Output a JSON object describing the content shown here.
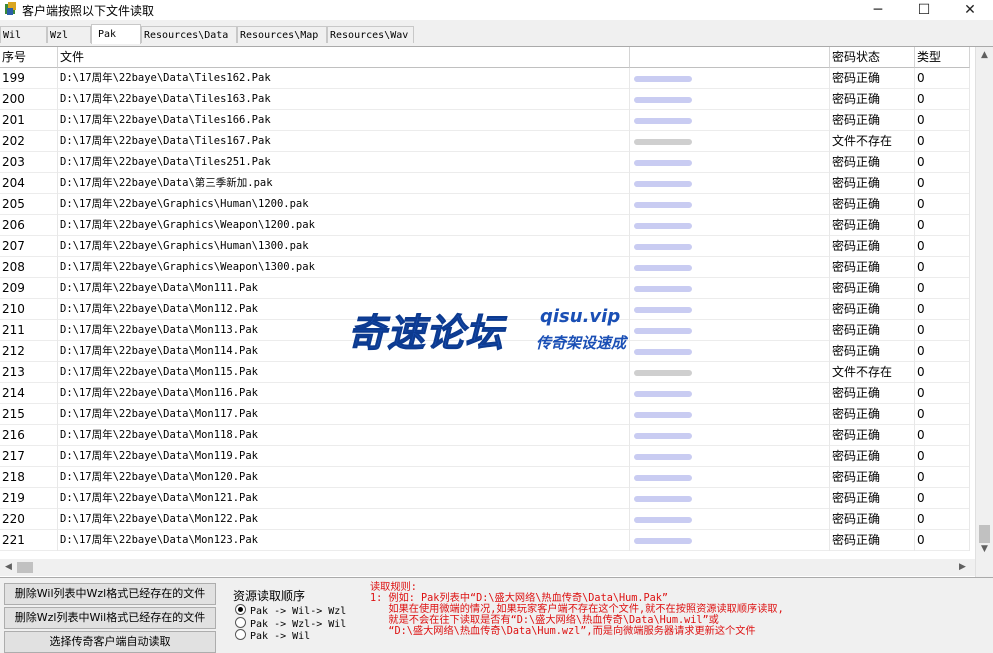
{
  "window": {
    "title": "客户端按照以下文件读取",
    "minimize": "─",
    "maximize": "☐",
    "close": "✕"
  },
  "tabs": [
    "Wil",
    "Wzl",
    "Pak",
    "Resources\\Data",
    "Resources\\Map",
    "Resources\\Wav"
  ],
  "active_tab": "Pak",
  "table": {
    "headers": [
      "序号",
      "文件",
      "",
      "密码状态",
      "类型"
    ],
    "rows": [
      {
        "no": "199",
        "file": "D:\\17周年\\22baye\\Data\\Tiles162.Pak",
        "status": "密码正确",
        "type": "0"
      },
      {
        "no": "200",
        "file": "D:\\17周年\\22baye\\Data\\Tiles163.Pak",
        "status": "密码正确",
        "type": "0"
      },
      {
        "no": "201",
        "file": "D:\\17周年\\22baye\\Data\\Tiles166.Pak",
        "status": "密码正确",
        "type": "0"
      },
      {
        "no": "202",
        "file": "D:\\17周年\\22baye\\Data\\Tiles167.Pak",
        "status": "文件不存在",
        "type": "0"
      },
      {
        "no": "203",
        "file": "D:\\17周年\\22baye\\Data\\Tiles251.Pak",
        "status": "密码正确",
        "type": "0"
      },
      {
        "no": "204",
        "file": "D:\\17周年\\22baye\\Data\\第三季新加.pak",
        "status": "密码正确",
        "type": "0"
      },
      {
        "no": "205",
        "file": "D:\\17周年\\22baye\\Graphics\\Human\\1200.pak",
        "status": "密码正确",
        "type": "0"
      },
      {
        "no": "206",
        "file": "D:\\17周年\\22baye\\Graphics\\Weapon\\1200.pak",
        "status": "密码正确",
        "type": "0"
      },
      {
        "no": "207",
        "file": "D:\\17周年\\22baye\\Graphics\\Human\\1300.pak",
        "status": "密码正确",
        "type": "0"
      },
      {
        "no": "208",
        "file": "D:\\17周年\\22baye\\Graphics\\Weapon\\1300.pak",
        "status": "密码正确",
        "type": "0"
      },
      {
        "no": "209",
        "file": "D:\\17周年\\22baye\\Data\\Mon111.Pak",
        "status": "密码正确",
        "type": "0"
      },
      {
        "no": "210",
        "file": "D:\\17周年\\22baye\\Data\\Mon112.Pak",
        "status": "密码正确",
        "type": "0"
      },
      {
        "no": "211",
        "file": "D:\\17周年\\22baye\\Data\\Mon113.Pak",
        "status": "密码正确",
        "type": "0"
      },
      {
        "no": "212",
        "file": "D:\\17周年\\22baye\\Data\\Mon114.Pak",
        "status": "密码正确",
        "type": "0"
      },
      {
        "no": "213",
        "file": "D:\\17周年\\22baye\\Data\\Mon115.Pak",
        "status": "文件不存在",
        "type": "0"
      },
      {
        "no": "214",
        "file": "D:\\17周年\\22baye\\Data\\Mon116.Pak",
        "status": "密码正确",
        "type": "0"
      },
      {
        "no": "215",
        "file": "D:\\17周年\\22baye\\Data\\Mon117.Pak",
        "status": "密码正确",
        "type": "0"
      },
      {
        "no": "216",
        "file": "D:\\17周年\\22baye\\Data\\Mon118.Pak",
        "status": "密码正确",
        "type": "0"
      },
      {
        "no": "217",
        "file": "D:\\17周年\\22baye\\Data\\Mon119.Pak",
        "status": "密码正确",
        "type": "0"
      },
      {
        "no": "218",
        "file": "D:\\17周年\\22baye\\Data\\Mon120.Pak",
        "status": "密码正确",
        "type": "0"
      },
      {
        "no": "219",
        "file": "D:\\17周年\\22baye\\Data\\Mon121.Pak",
        "status": "密码正确",
        "type": "0"
      },
      {
        "no": "220",
        "file": "D:\\17周年\\22baye\\Data\\Mon122.Pak",
        "status": "密码正确",
        "type": "0"
      },
      {
        "no": "221",
        "file": "D:\\17周年\\22baye\\Data\\Mon123.Pak",
        "status": "密码正确",
        "type": "0"
      }
    ]
  },
  "watermark": {
    "main": "奇速论坛",
    "url": "qisu.vip",
    "sub": "传奇架设速成"
  },
  "buttons": {
    "delete_wil": "删除Wil列表中Wzl格式已经存在的文件",
    "delete_wzl": "删除Wzl列表中Wil格式已经存在的文件",
    "auto_read": "选择传奇客户端自动读取"
  },
  "read_order": {
    "title": "资源读取顺序",
    "options": [
      "Pak -> Wil-> Wzl",
      "Pak -> Wzl-> Wil",
      "Pak -> Wil"
    ],
    "selected": 0
  },
  "rules": {
    "title": "读取规则:",
    "line1": "1: 例如: Pak列表中“D:\\盛大网络\\热血传奇\\Data\\Hum.Pak”",
    "line2": "   如果在使用微端的情况,如果玩家客户端不存在这个文件,就不在按照资源读取顺序读取,",
    "line3": "   就是不会在往下读取是否有“D:\\盛大网络\\热血传奇\\Data\\Hum.wil”或",
    "line4": "   “D:\\盛大网络\\热血传奇\\Data\\Hum.wzl”,而是向微端服务器请求更新这个文件"
  }
}
